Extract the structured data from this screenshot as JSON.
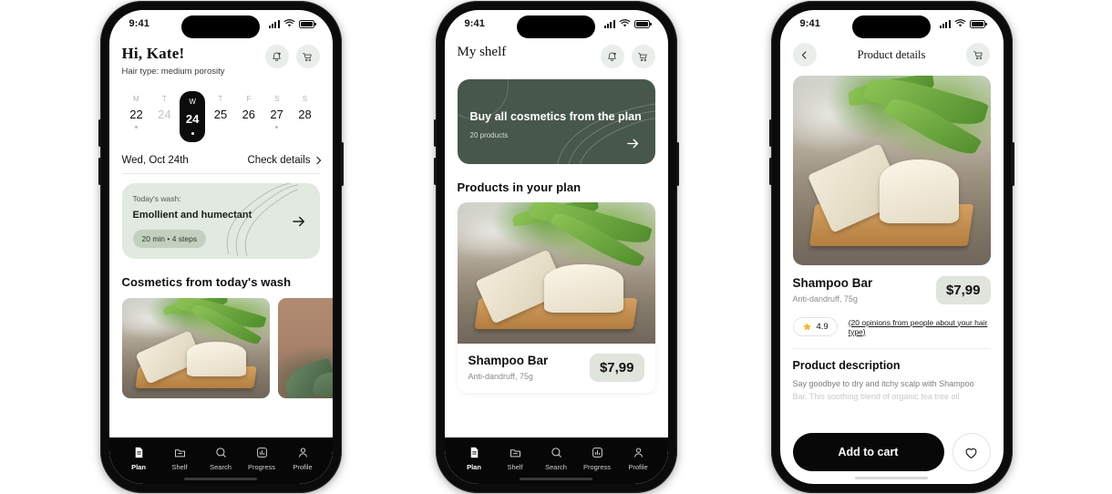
{
  "statusbar": {
    "time": "9:41"
  },
  "screen1": {
    "greeting": "Hi, Kate!",
    "hair_type": "Hair type: medium porosity",
    "actions": {
      "notifications": "bell-icon",
      "cart": "cart-icon"
    },
    "week": [
      {
        "weekday": "M",
        "date": "22",
        "dot": true,
        "active": false,
        "muted": false
      },
      {
        "weekday": "T",
        "date": "24",
        "dot": false,
        "active": false,
        "muted": true
      },
      {
        "weekday": "W",
        "date": "24",
        "dot": true,
        "active": true,
        "muted": false
      },
      {
        "weekday": "T",
        "date": "25",
        "dot": false,
        "active": false,
        "muted": false
      },
      {
        "weekday": "F",
        "date": "26",
        "dot": false,
        "active": false,
        "muted": false
      },
      {
        "weekday": "S",
        "date": "27",
        "dot": true,
        "active": false,
        "muted": false
      },
      {
        "weekday": "S",
        "date": "28",
        "dot": false,
        "active": false,
        "muted": false
      }
    ],
    "date_row": {
      "date": "Wed, Oct 24th",
      "link": "Check details"
    },
    "wash_card": {
      "label": "Today's wash:",
      "title": "Emollient and humectant",
      "meta": "20 min  •  4 steps"
    },
    "cosmetics_title": "Cosmetics from today's wash"
  },
  "screen2": {
    "title": "My shelf",
    "promo": {
      "title": "Buy all cosmetics from the plan",
      "subtitle": "20 products"
    },
    "section_title": "Products in your plan",
    "product": {
      "name": "Shampoo Bar",
      "desc": "Anti-dandruff, 75g",
      "price": "$7,99"
    }
  },
  "screen3": {
    "nav_title": "Product details",
    "back": "back-chevron-icon",
    "cart": "cart-icon",
    "product": {
      "name": "Shampoo Bar",
      "desc": "Anti-dandruff, 75g",
      "price": "$7,99"
    },
    "rating": {
      "value": "4.9",
      "opinions": "(20 opinions from people about your hair type)"
    },
    "description_title": "Product description",
    "description_line1": "Say goodbye to dry and itchy scalp with  Shampoo",
    "description_line2": "Bar. This soothing blend of organic tea tree oil",
    "cta": {
      "primary": "Add to cart",
      "favorite": "heart-icon"
    }
  },
  "tabbar": {
    "items": [
      {
        "label": "Plan",
        "icon": "document-icon",
        "active": true
      },
      {
        "label": "Shelf",
        "icon": "shelf-icon",
        "active": false
      },
      {
        "label": "Search",
        "icon": "search-icon",
        "active": false
      },
      {
        "label": "Progress",
        "icon": "chart-icon",
        "active": false
      },
      {
        "label": "Profile",
        "icon": "person-icon",
        "active": false
      }
    ]
  },
  "colors": {
    "accent_green": "#47574b",
    "soft_green": "#e2e9e1",
    "pill_green": "#c3d0c0",
    "price_chip": "#dfe4dc",
    "star": "#f5b731",
    "dark": "#080808"
  }
}
